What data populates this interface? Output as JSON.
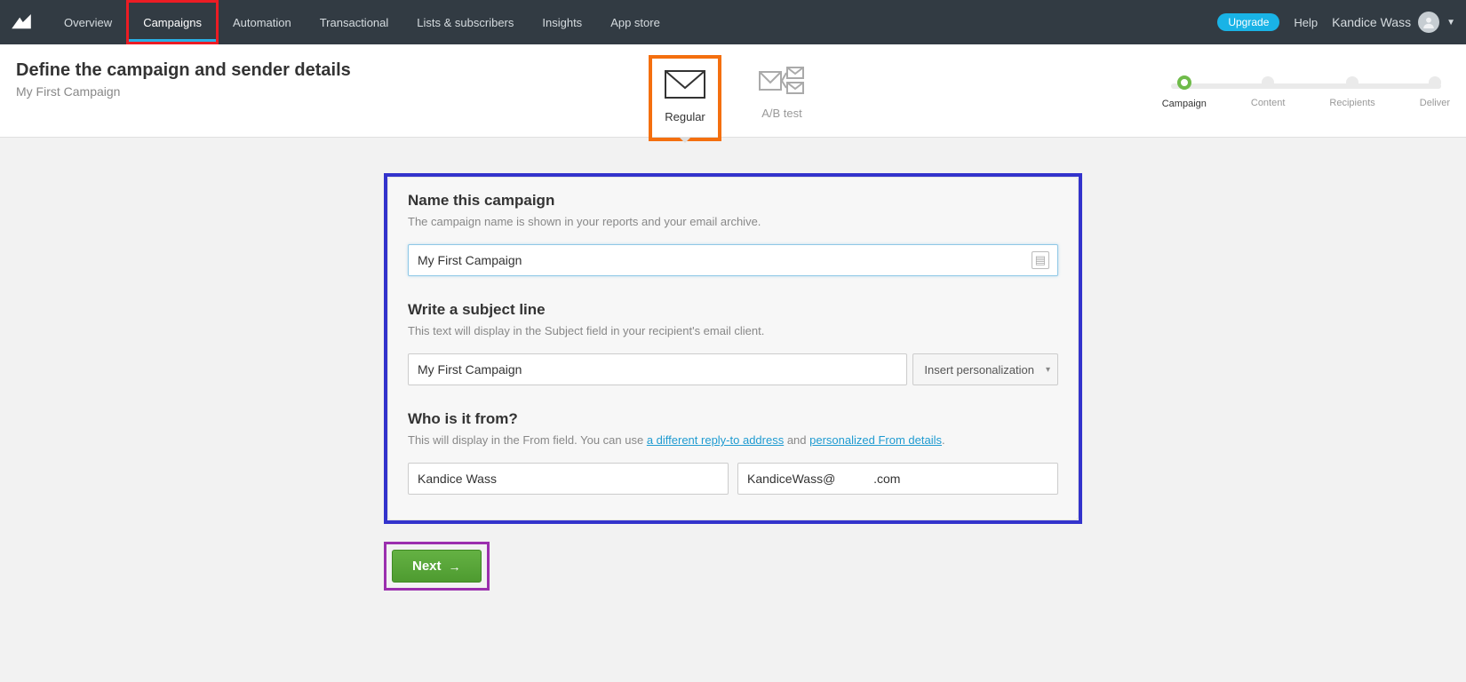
{
  "nav": {
    "items": [
      "Overview",
      "Campaigns",
      "Automation",
      "Transactional",
      "Lists & subscribers",
      "Insights",
      "App store"
    ],
    "active_index": 1,
    "upgrade": "Upgrade",
    "help": "Help",
    "user_name": "Kandice Wass"
  },
  "subheader": {
    "title": "Define the campaign and sender details",
    "subtitle": "My First Campaign",
    "type_tabs": [
      {
        "label": "Regular",
        "active": true
      },
      {
        "label": "A/B test",
        "active": false
      }
    ],
    "steps": [
      "Campaign",
      "Content",
      "Recipients",
      "Deliver"
    ],
    "active_step": 0
  },
  "form": {
    "name_section": {
      "heading": "Name this campaign",
      "desc": "The campaign name is shown in your reports and your email archive.",
      "value": "My First Campaign"
    },
    "subject_section": {
      "heading": "Write a subject line",
      "desc": "This text will display in the Subject field in your recipient's email client.",
      "value": "My First Campaign",
      "insert_label": "Insert personalization"
    },
    "from_section": {
      "heading": "Who is it from?",
      "desc_pre": "This will display in the From field. You can use ",
      "link1": "a different reply-to address",
      "desc_mid": " and ",
      "link2": "personalized From details",
      "desc_post": ".",
      "from_name": "Kandice Wass",
      "from_email": "KandiceWass@           .com"
    }
  },
  "next_label": "Next"
}
